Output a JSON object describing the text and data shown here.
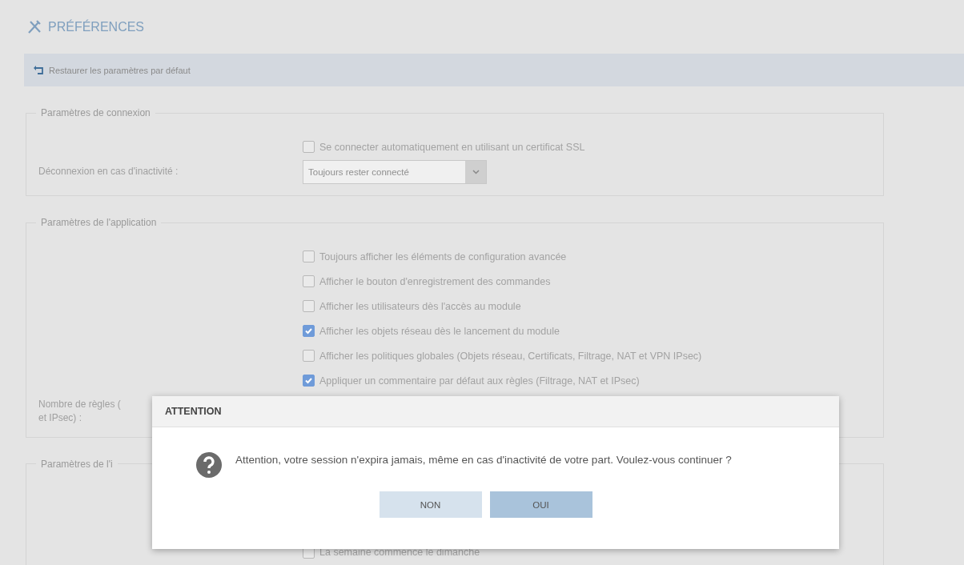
{
  "page": {
    "title": "PRÉFÉRENCES"
  },
  "toolbar": {
    "restore_button": "Restaurer les paramètres par défaut"
  },
  "sections": [
    {
      "title": "Paramètres de connexion",
      "rows": [
        {
          "kind": "checkbox",
          "label": "Se connecter automatiquement en utilisant un certificat SSL",
          "checked": false
        },
        {
          "kind": "select",
          "label": "Déconnexion en cas d'inactivité :",
          "value": "Toujours rester connecté"
        }
      ]
    },
    {
      "title": "Paramètres de l'application",
      "rows": [
        {
          "kind": "checkbox",
          "label": "Toujours afficher les éléments de configuration avancée",
          "checked": false
        },
        {
          "kind": "checkbox",
          "label": "Afficher le bouton d'enregistrement des commandes",
          "checked": false
        },
        {
          "kind": "checkbox",
          "label": "Afficher les utilisateurs dès l'accès au module",
          "checked": false
        },
        {
          "kind": "checkbox",
          "label": "Afficher les objets réseau dès le lancement du module",
          "checked": true
        },
        {
          "kind": "checkbox",
          "label": "Afficher les politiques globales (Objets réseau, Certificats, Filtrage, NAT et VPN IPsec)",
          "checked": false
        },
        {
          "kind": "checkbox",
          "label": "Appliquer un commentaire par défaut aux règles (Filtrage, NAT et IPsec)",
          "checked": true
        },
        {
          "kind": "label",
          "label": "Nombre de règles (\net IPsec) :"
        }
      ]
    },
    {
      "title": "Paramètres de l'i",
      "rows": [
        {
          "kind": "checkbox",
          "label": "La semaine commence le dimanche",
          "checked": false
        }
      ]
    }
  ],
  "dialog": {
    "title": "ATTENTION",
    "message": "Attention, votre session n'expira jamais, même en cas d'inactivité de votre part. Voulez-vous continuer ?",
    "buttons": [
      {
        "label": "NON",
        "selected": false
      },
      {
        "label": "OUI",
        "selected": true
      }
    ]
  }
}
